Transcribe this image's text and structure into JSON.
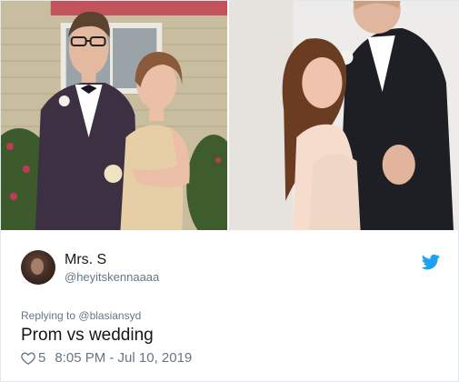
{
  "tweet": {
    "display_name": "Mrs. S",
    "handle": "@heyitskennaaaa",
    "reply_prefix": "Replying to",
    "reply_handle": "@blasiansyd",
    "text": "Prom vs wedding",
    "likes": "5",
    "timestamp": "8:05 PM - Jul 10, 2019"
  },
  "icons": {
    "brand": "twitter-bird-icon",
    "like": "heart-icon"
  },
  "colors": {
    "twitter_blue": "#1da1f2",
    "secondary_text": "#657786",
    "primary_text": "#14171a"
  }
}
